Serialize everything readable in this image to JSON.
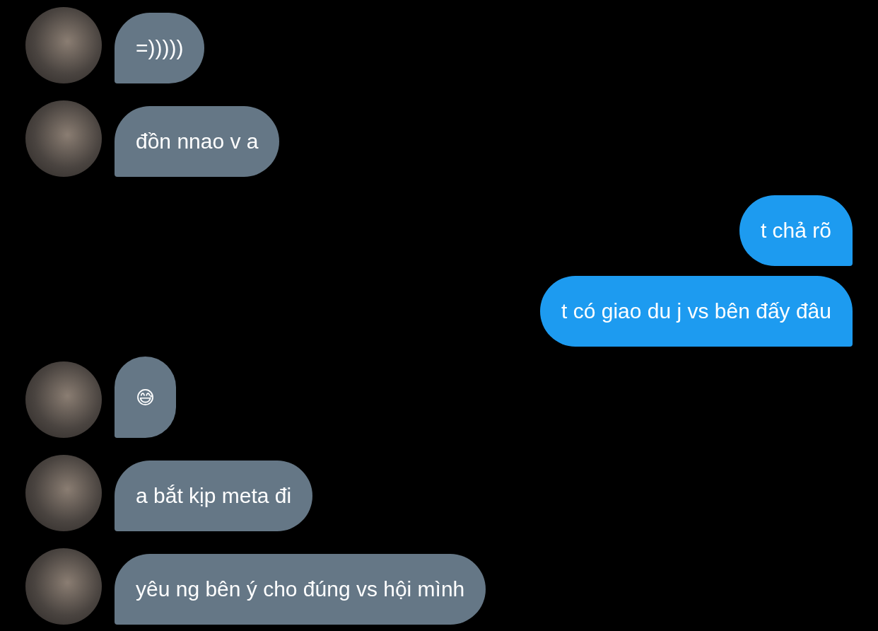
{
  "messages": [
    {
      "outgoing": false,
      "kind": "text",
      "text": "=)))))"
    },
    {
      "outgoing": false,
      "kind": "text",
      "text": "đồn nnao v a"
    },
    {
      "outgoing": true,
      "kind": "text",
      "text": "t chả rõ"
    },
    {
      "outgoing": true,
      "kind": "text",
      "text": "t có giao du j vs bên đấy đâu"
    },
    {
      "outgoing": false,
      "kind": "emoji",
      "text": "😅"
    },
    {
      "outgoing": false,
      "kind": "text",
      "text": "a bắt kịp meta đi"
    },
    {
      "outgoing": false,
      "kind": "text",
      "text": "yêu ng bên ý cho đúng vs hội mình"
    }
  ]
}
